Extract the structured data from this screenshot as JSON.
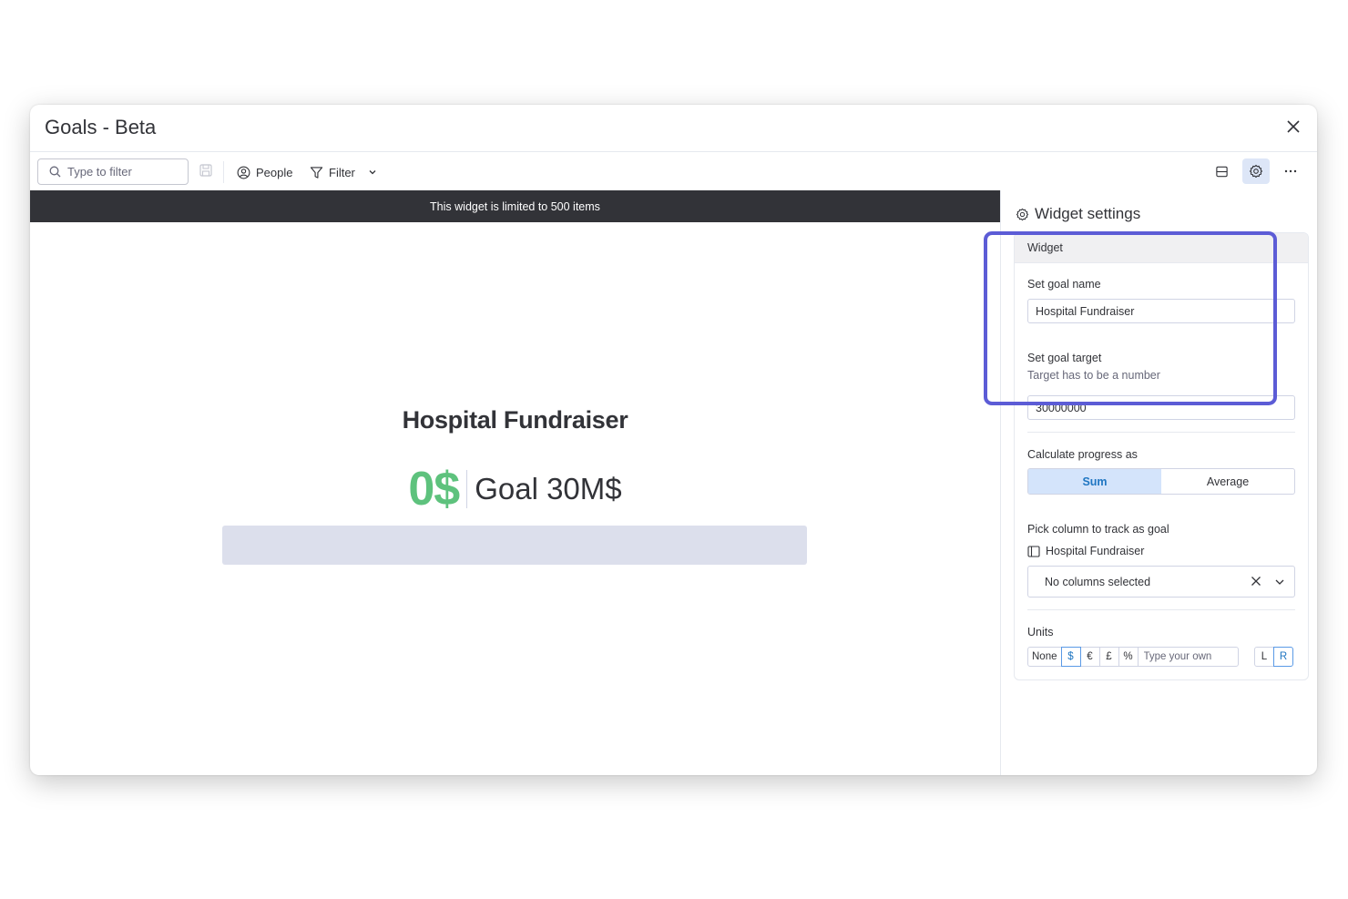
{
  "window": {
    "title": "Goals - Beta"
  },
  "toolbar": {
    "search_placeholder": "Type to filter",
    "people_label": "People",
    "filter_label": "Filter"
  },
  "banner": {
    "text": "This widget is limited to 500 items"
  },
  "goal": {
    "name": "Hospital Fundraiser",
    "current_display": "0$",
    "target_display": "Goal 30M$",
    "progress_fraction": 0,
    "progress_color": "#5ec27d",
    "track_color": "#dcdfec"
  },
  "settings": {
    "header": "Widget settings",
    "section": "Widget",
    "goal_name_label": "Set goal name",
    "goal_name_value": "Hospital Fundraiser",
    "goal_target_label": "Set goal target",
    "goal_target_hint": "Target has to be a number",
    "goal_target_value": "30000000",
    "calc_label": "Calculate progress as",
    "calc_options": [
      "Sum",
      "Average"
    ],
    "calc_selected": "Sum",
    "pick_column_label": "Pick column to track as goal",
    "board_name": "Hospital Fundraiser",
    "columns_value": "No columns selected",
    "units_label": "Units",
    "units_options": [
      "None",
      "$",
      "€",
      "£",
      "%"
    ],
    "units_selected": "$",
    "units_custom_placeholder": "Type your own",
    "position_options": [
      "L",
      "R"
    ],
    "position_selected": "R"
  },
  "colors": {
    "accent": "#5c5cd6",
    "banner_bg": "#323338",
    "selected_bg": "#d4e4fb"
  }
}
